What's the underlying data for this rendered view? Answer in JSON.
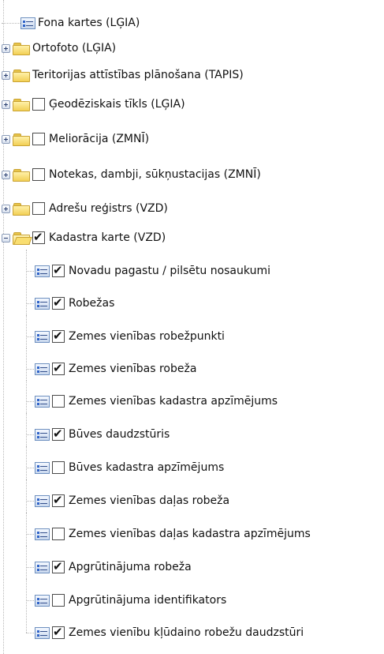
{
  "tree": {
    "items": [
      {
        "label": "Fona kartes (LĢIA)",
        "level": 0,
        "type": "layer",
        "expander": "none",
        "checkbox": "none"
      },
      {
        "label": "Ortofoto (LĢIA)",
        "level": 0,
        "type": "folder",
        "expander": "plus",
        "checkbox": "none"
      },
      {
        "label": "Teritorijas attīstības plānošana (TAPIS)",
        "level": 0,
        "type": "folder",
        "expander": "plus",
        "checkbox": "none"
      },
      {
        "label": "Ģeodēziskais tīkls (LĢIA)",
        "level": 0,
        "type": "folder",
        "expander": "plus",
        "checkbox": "unchecked"
      },
      {
        "label": "Meliorācija (ZMNĪ)",
        "level": 0,
        "type": "folder",
        "expander": "plus",
        "checkbox": "unchecked"
      },
      {
        "label": "Notekas, dambji, sūkņustacijas (ZMNĪ)",
        "level": 0,
        "type": "folder",
        "expander": "plus",
        "checkbox": "unchecked"
      },
      {
        "label": "Adrešu reģistrs (VZD)",
        "level": 0,
        "type": "folder",
        "expander": "plus",
        "checkbox": "unchecked"
      },
      {
        "label": "Kadastra karte (VZD)",
        "level": 0,
        "type": "folder-open",
        "expander": "minus",
        "checkbox": "checked"
      },
      {
        "label": "Novadu pagastu / pilsētu nosaukumi",
        "level": 1,
        "type": "layer",
        "expander": "none",
        "checkbox": "checked"
      },
      {
        "label": "Robežas",
        "level": 1,
        "type": "layer",
        "expander": "none",
        "checkbox": "checked"
      },
      {
        "label": "Zemes vienības robežpunkti",
        "level": 1,
        "type": "layer",
        "expander": "none",
        "checkbox": "checked"
      },
      {
        "label": "Zemes vienības robeža",
        "level": 1,
        "type": "layer",
        "expander": "none",
        "checkbox": "checked"
      },
      {
        "label": "Zemes vienības kadastra apzīmējums",
        "level": 1,
        "type": "layer",
        "expander": "none",
        "checkbox": "unchecked"
      },
      {
        "label": "Būves daudzstūris",
        "level": 1,
        "type": "layer",
        "expander": "none",
        "checkbox": "checked"
      },
      {
        "label": "Būves kadastra apzīmējums",
        "level": 1,
        "type": "layer",
        "expander": "none",
        "checkbox": "unchecked"
      },
      {
        "label": "Zemes vienības daļas robeža",
        "level": 1,
        "type": "layer",
        "expander": "none",
        "checkbox": "checked"
      },
      {
        "label": "Zemes vienības daļas kadastra apzīmējums",
        "level": 1,
        "type": "layer",
        "expander": "none",
        "checkbox": "unchecked"
      },
      {
        "label": "Apgrūtinājuma robeža",
        "level": 1,
        "type": "layer",
        "expander": "none",
        "checkbox": "checked"
      },
      {
        "label": "Apgrūtinājuma identifikators",
        "level": 1,
        "type": "layer",
        "expander": "none",
        "checkbox": "unchecked"
      },
      {
        "label": "Zemes vienību kļūdaino robežu daudzstūri",
        "level": 1,
        "type": "layer",
        "expander": "none",
        "checkbox": "checked"
      }
    ]
  }
}
